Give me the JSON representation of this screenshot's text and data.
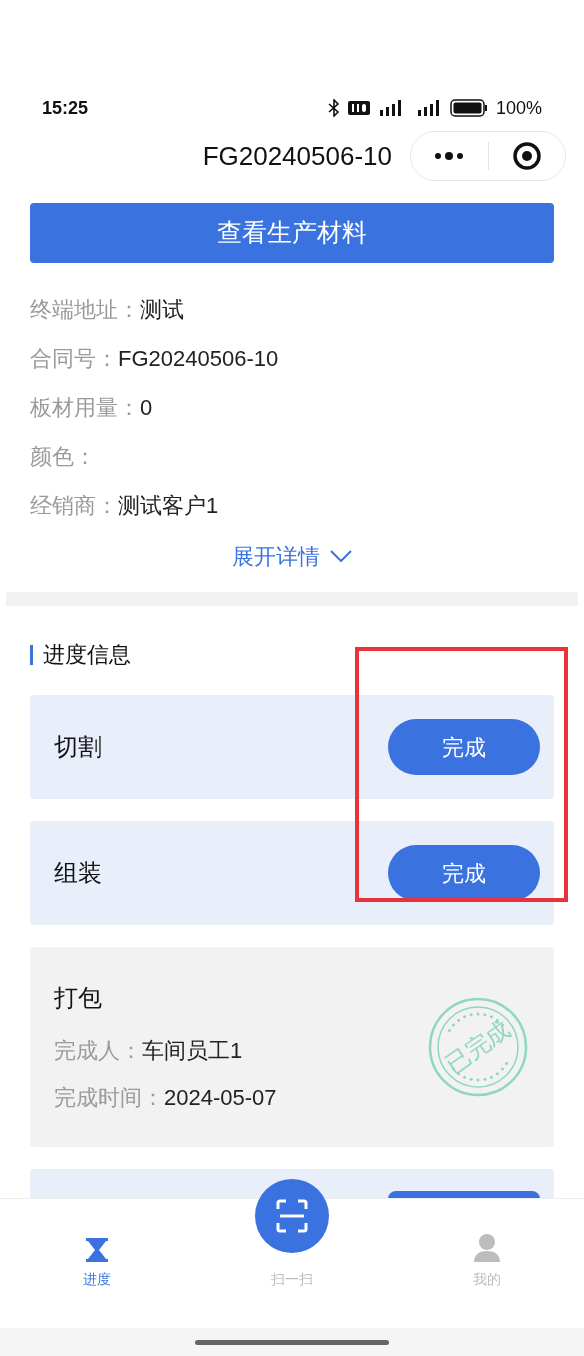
{
  "status_bar": {
    "time": "15:25",
    "battery": "100%"
  },
  "nav": {
    "title": "FG20240506-10"
  },
  "primary_button": "查看生产材料",
  "info": [
    {
      "label": "终端地址：",
      "value": "测试"
    },
    {
      "label": "合同号：",
      "value": "FG20240506-10"
    },
    {
      "label": "板材用量：",
      "value": "0"
    },
    {
      "label": "颜色："
    },
    {
      "label": "经销商：",
      "value": "测试客户1"
    }
  ],
  "expand_link": "展开详情",
  "section_title": "进度信息",
  "steps": [
    {
      "kind": "pending",
      "name": "切割",
      "button": "完成"
    },
    {
      "kind": "pending",
      "name": "组装",
      "button": "完成"
    },
    {
      "kind": "done",
      "name": "打包",
      "details": [
        {
          "label": "完成人：",
          "value": "车间员工1"
        },
        {
          "label": "完成时间：",
          "value": "2024-05-07"
        }
      ],
      "stamp": "已完成"
    },
    {
      "kind": "hidden"
    }
  ],
  "tabs": [
    {
      "kind": "hourglass",
      "label": "进度",
      "selected": true
    },
    {
      "kind": "scan",
      "label": "扫一扫",
      "selected": false
    },
    {
      "kind": "user",
      "label": "我的",
      "selected": false
    }
  ]
}
